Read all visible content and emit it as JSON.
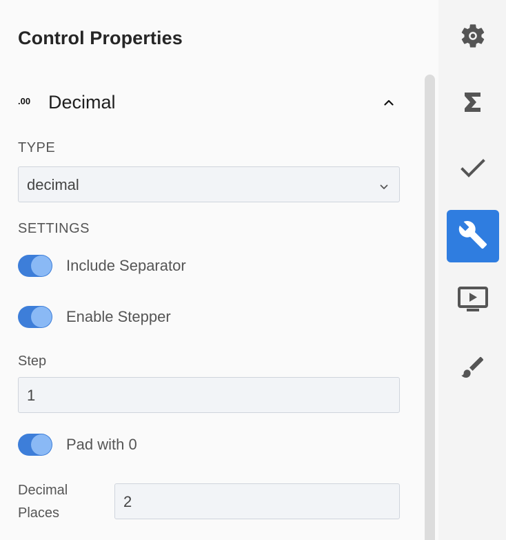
{
  "panel": {
    "title": "Control Properties",
    "section": {
      "icon_text": ".00",
      "title": "Decimal",
      "collapse_icon": "chevron-up-icon"
    },
    "type_label": "TYPE",
    "type_select": {
      "value": "decimal",
      "icon": "chevron-down-icon"
    },
    "settings_label": "SETTINGS",
    "toggles": [
      {
        "label": "Include Separator",
        "checked": true
      },
      {
        "label": "Enable Stepper",
        "checked": true
      },
      {
        "label": "Pad with 0",
        "checked": true
      }
    ],
    "step": {
      "label": "Step",
      "value": "1"
    },
    "decimal_places": {
      "label_line1": "Decimal",
      "label_line2": "Places",
      "value": "2"
    }
  },
  "rail": {
    "items": [
      {
        "icon": "gear-icon",
        "active": false
      },
      {
        "icon": "sigma-icon",
        "active": false
      },
      {
        "icon": "checkmark-icon",
        "active": false
      },
      {
        "icon": "wrench-icon",
        "active": true
      },
      {
        "icon": "preview-icon",
        "active": false
      },
      {
        "icon": "brush-icon",
        "active": false
      }
    ],
    "active_color": "#2f7de0"
  },
  "colors": {
    "toggle_track": "#3d7ed9",
    "toggle_knob": "#8ab9f5",
    "input_bg": "#f2f4f7"
  }
}
